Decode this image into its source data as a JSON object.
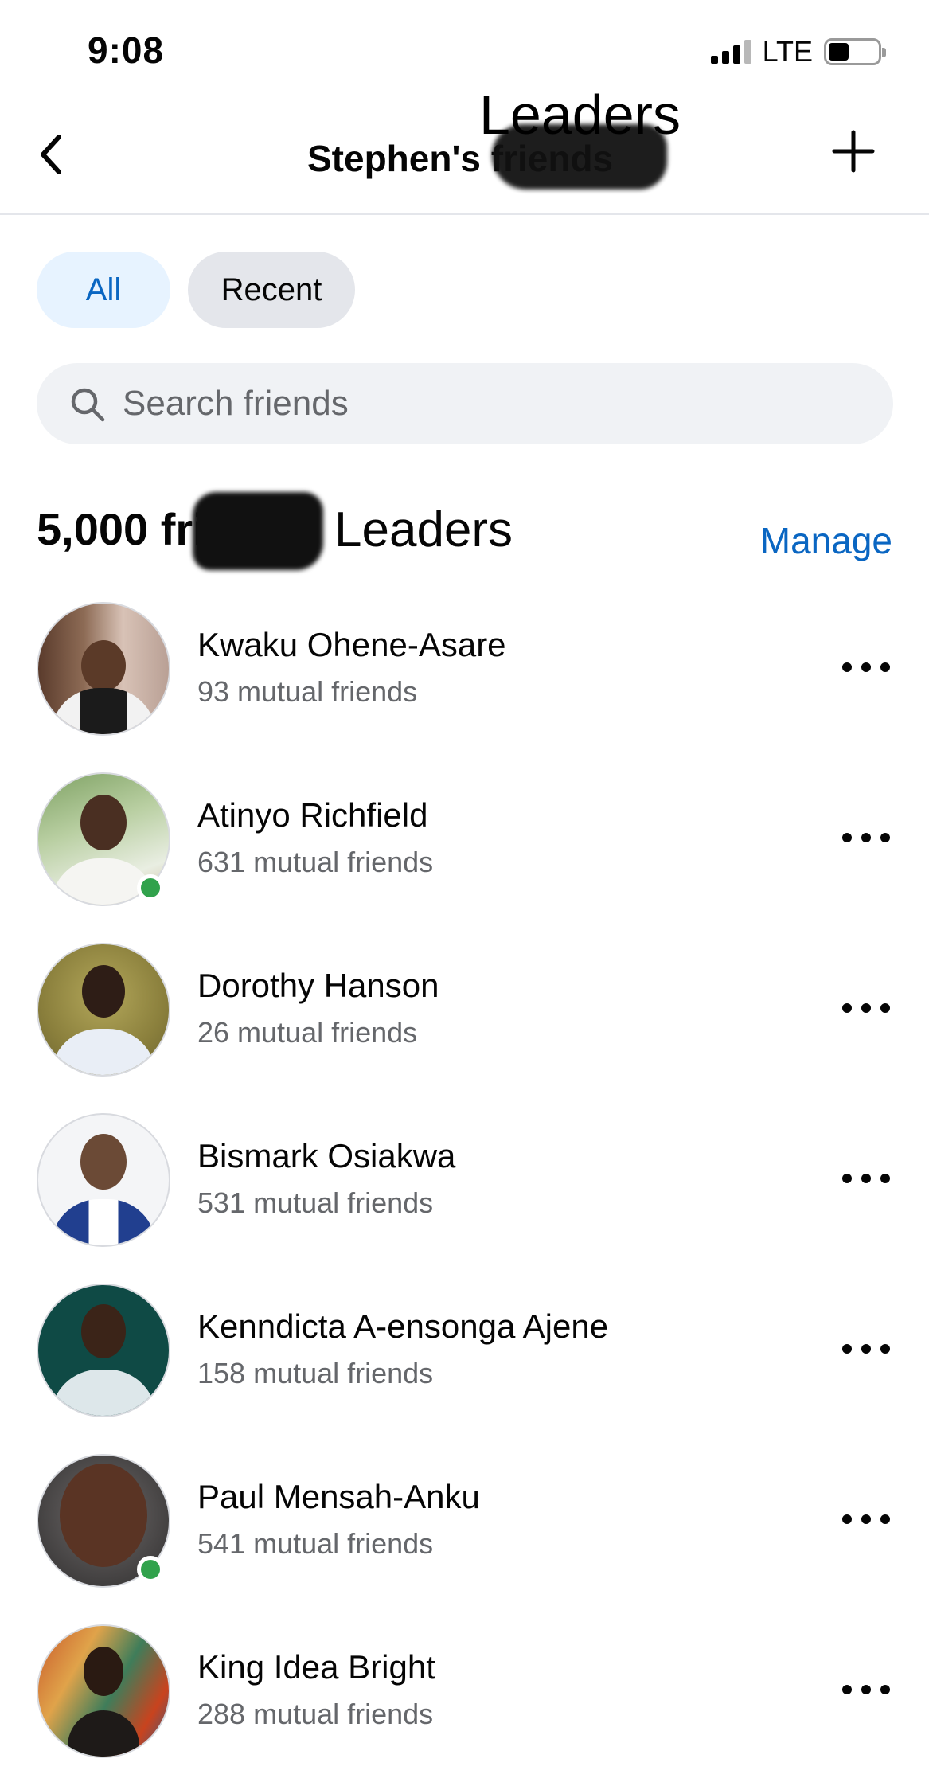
{
  "status_bar": {
    "time": "9:08",
    "network": "LTE",
    "battery_level": 0.42
  },
  "header": {
    "title": "Stephen's friends",
    "overlay_text": "Leaders",
    "back_icon": "chevron-left-icon",
    "add_icon": "plus-icon"
  },
  "filters": {
    "all_label": "All",
    "recent_label": "Recent",
    "selected": "All"
  },
  "search": {
    "placeholder": "Search friends",
    "value": ""
  },
  "section": {
    "count_label": "5,000 friends",
    "overlay_text": "Leaders",
    "manage_label": "Manage"
  },
  "friends": [
    {
      "name": "Kwaku Ohene-Asare",
      "mutual": "93 mutual friends",
      "online": false
    },
    {
      "name": "Atinyo Richfield",
      "mutual": "631 mutual friends",
      "online": true
    },
    {
      "name": "Dorothy Hanson",
      "mutual": "26 mutual friends",
      "online": false
    },
    {
      "name": "Bismark Osiakwa",
      "mutual": "531 mutual friends",
      "online": false
    },
    {
      "name": "Kenndicta A-ensonga Ajene",
      "mutual": "158 mutual friends",
      "online": false
    },
    {
      "name": "Paul Mensah-Anku",
      "mutual": "541 mutual friends",
      "online": true
    },
    {
      "name": "King Idea Bright",
      "mutual": "288 mutual friends",
      "online": false
    }
  ],
  "colors": {
    "accent": "#0a66c2",
    "selected_pill_bg": "#e7f3ff",
    "pill_bg": "#e4e6eb",
    "search_bg": "#f0f2f5",
    "secondary_text": "#65676b",
    "online": "#31a24c"
  }
}
